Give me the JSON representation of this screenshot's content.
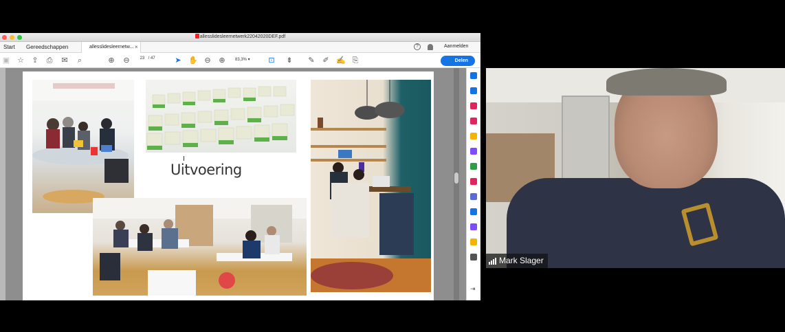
{
  "window": {
    "title": "allesslidesleernetwerk22042020DEF.pdf"
  },
  "tabs": {
    "start": "Start",
    "tools": "Gereedschappen",
    "document": "allesslidesleernetw...",
    "close": "×"
  },
  "header": {
    "help": "?",
    "sign_in": "Aanmelden"
  },
  "toolbar": {
    "page_current": "23",
    "page_total": "/ 47",
    "zoom": "83,3%",
    "share_label": "Delen"
  },
  "slide": {
    "title": "Uitvoering"
  },
  "video": {
    "participant_name": "Mark Slager"
  },
  "colors": {
    "accent": "#1473e6",
    "right_panel_icons": [
      "#1473e6",
      "#1473e6",
      "#e0245e",
      "#e0245e",
      "#f5b400",
      "#7c4dff",
      "#2e9e44",
      "#e0245e",
      "#5b6bd6",
      "#1473e6",
      "#7c4dff",
      "#f5b400",
      "#555555"
    ]
  }
}
